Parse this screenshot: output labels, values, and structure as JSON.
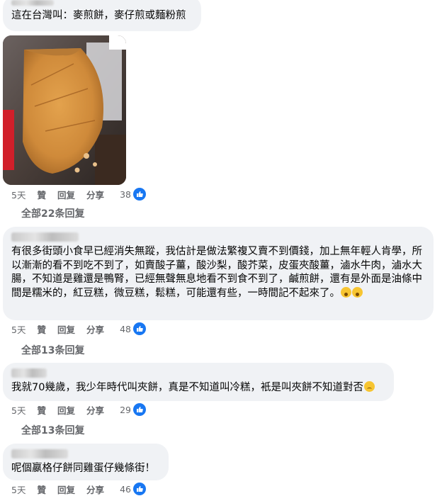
{
  "comments": [
    {
      "text": "這在台灣叫：麥煎餅，麥仔煎或麵粉煎",
      "actions": {
        "time": "5天",
        "like": "贊",
        "reply": "回复",
        "share": "分享",
        "reactions": "38"
      },
      "replies_label": "全部22条回复"
    },
    {
      "text": "有很多街頭小食早已經消失無蹤，我估計是做法繁複又賣不到價錢，加上無年輕人肯學，所以漸漸的看不到吃不到了，如賣酸子薑，酸沙梨，酸芥菜，皮蛋夾酸薑，滷水牛肉，滷水大腸，不知道是雞還是鴨腎，已經無聲無息地看不到食不到了，鹹煎餅，還有是外面是油條中間是糯米的，紅豆糕，微豆糕，鬆糕，可能還有些，一時間記不起來了。",
      "actions": {
        "time": "5天",
        "like": "贊",
        "reply": "回复",
        "share": "分享",
        "reactions": "48"
      },
      "replies_label": "全部13条回复"
    },
    {
      "text": "我就70幾歲，我少年時代叫夾餅，真是不知道叫冷糕，衹是叫夾餅不知道對否",
      "actions": {
        "time": "5天",
        "like": "贊",
        "reply": "回复",
        "share": "分享",
        "reactions": "29"
      },
      "replies_label": "全部13条回复"
    },
    {
      "text": "呢個嬴格仔餅同雞蛋仔幾條街！",
      "actions": {
        "time": "5天",
        "like": "贊",
        "reply": "回复",
        "share": "分享",
        "reactions": "46"
      }
    }
  ],
  "icons": {
    "like": "thumbs-up-icon",
    "reply_arrow": "reply-arrow-icon"
  },
  "colors": {
    "bubble": "#f0f2f5",
    "secondary_text": "#65676b",
    "like_blue": "#1877f2"
  }
}
